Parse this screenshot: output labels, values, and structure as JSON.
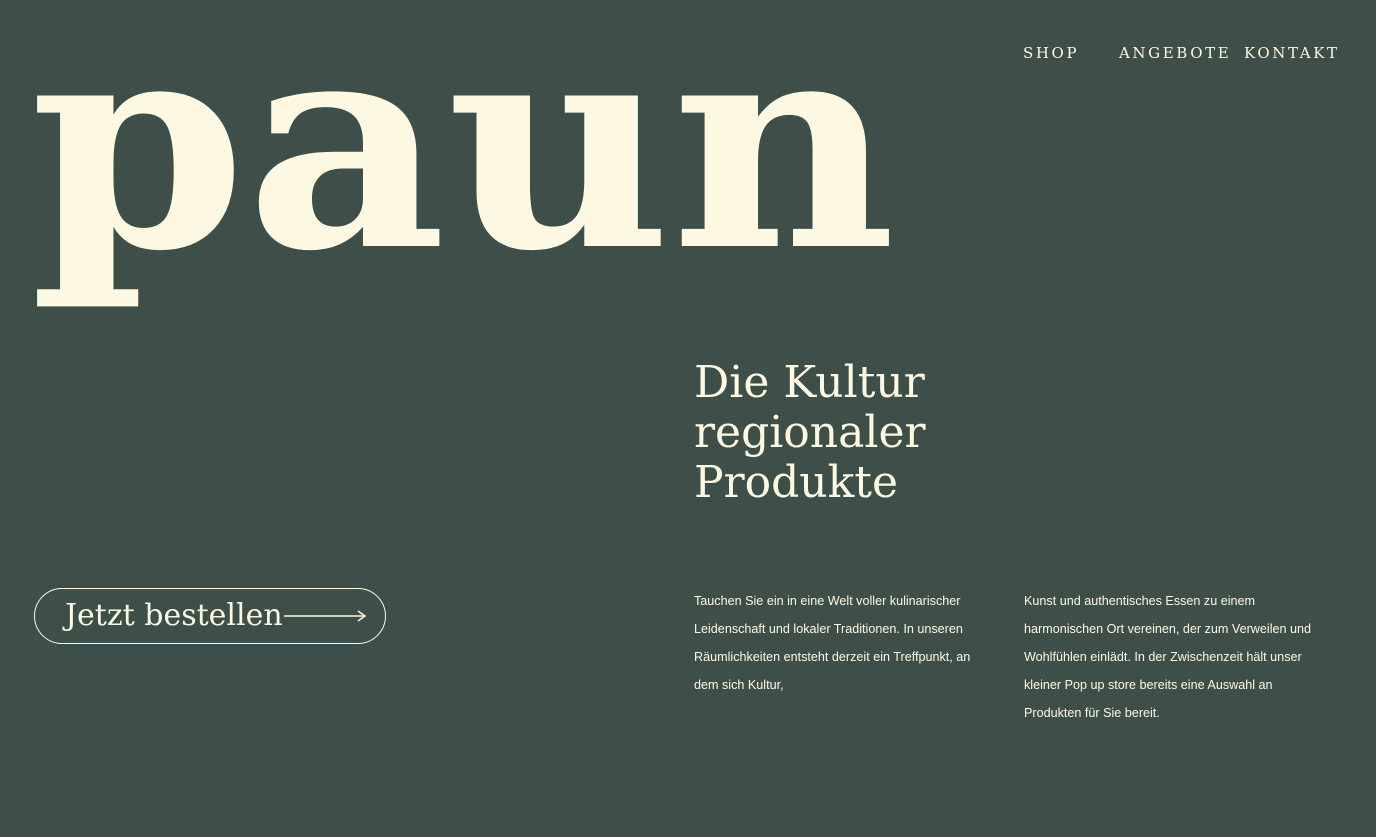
{
  "brand": {
    "logo_text": "paun"
  },
  "nav": {
    "shop": "SHOP",
    "angebote": "ANGEBOTE",
    "kontakt": "KONTAKT"
  },
  "hero": {
    "headline_lines": [
      "Die Kultur",
      "regionaler",
      "Produkte"
    ],
    "cta_label": "Jetzt bestellen"
  },
  "intro": {
    "column_1_lines": [
      "Tauchen Sie ein in eine Welt voller kulinarischer",
      "Leidenschaft und lokaler Traditionen. In unseren",
      "Räumlichkeiten entsteht derzeit ein Treffpunkt, an",
      "dem sich Kultur,"
    ],
    "column_2_lines": [
      " Kunst und authentisches Essen zu einem",
      "harmonischen Ort vereinen, der zum Verweilen und",
      "Wohlfühlen einlädt. In der Zwischenzeit hält unser",
      "kleiner Pop up store bereits eine Auswahl an",
      "Produkten für Sie bereit."
    ]
  },
  "colors": {
    "background": "#3e4f4a",
    "foreground": "#fdf8e1"
  },
  "icons": {
    "cta_arrow": "arrow-right-icon"
  }
}
